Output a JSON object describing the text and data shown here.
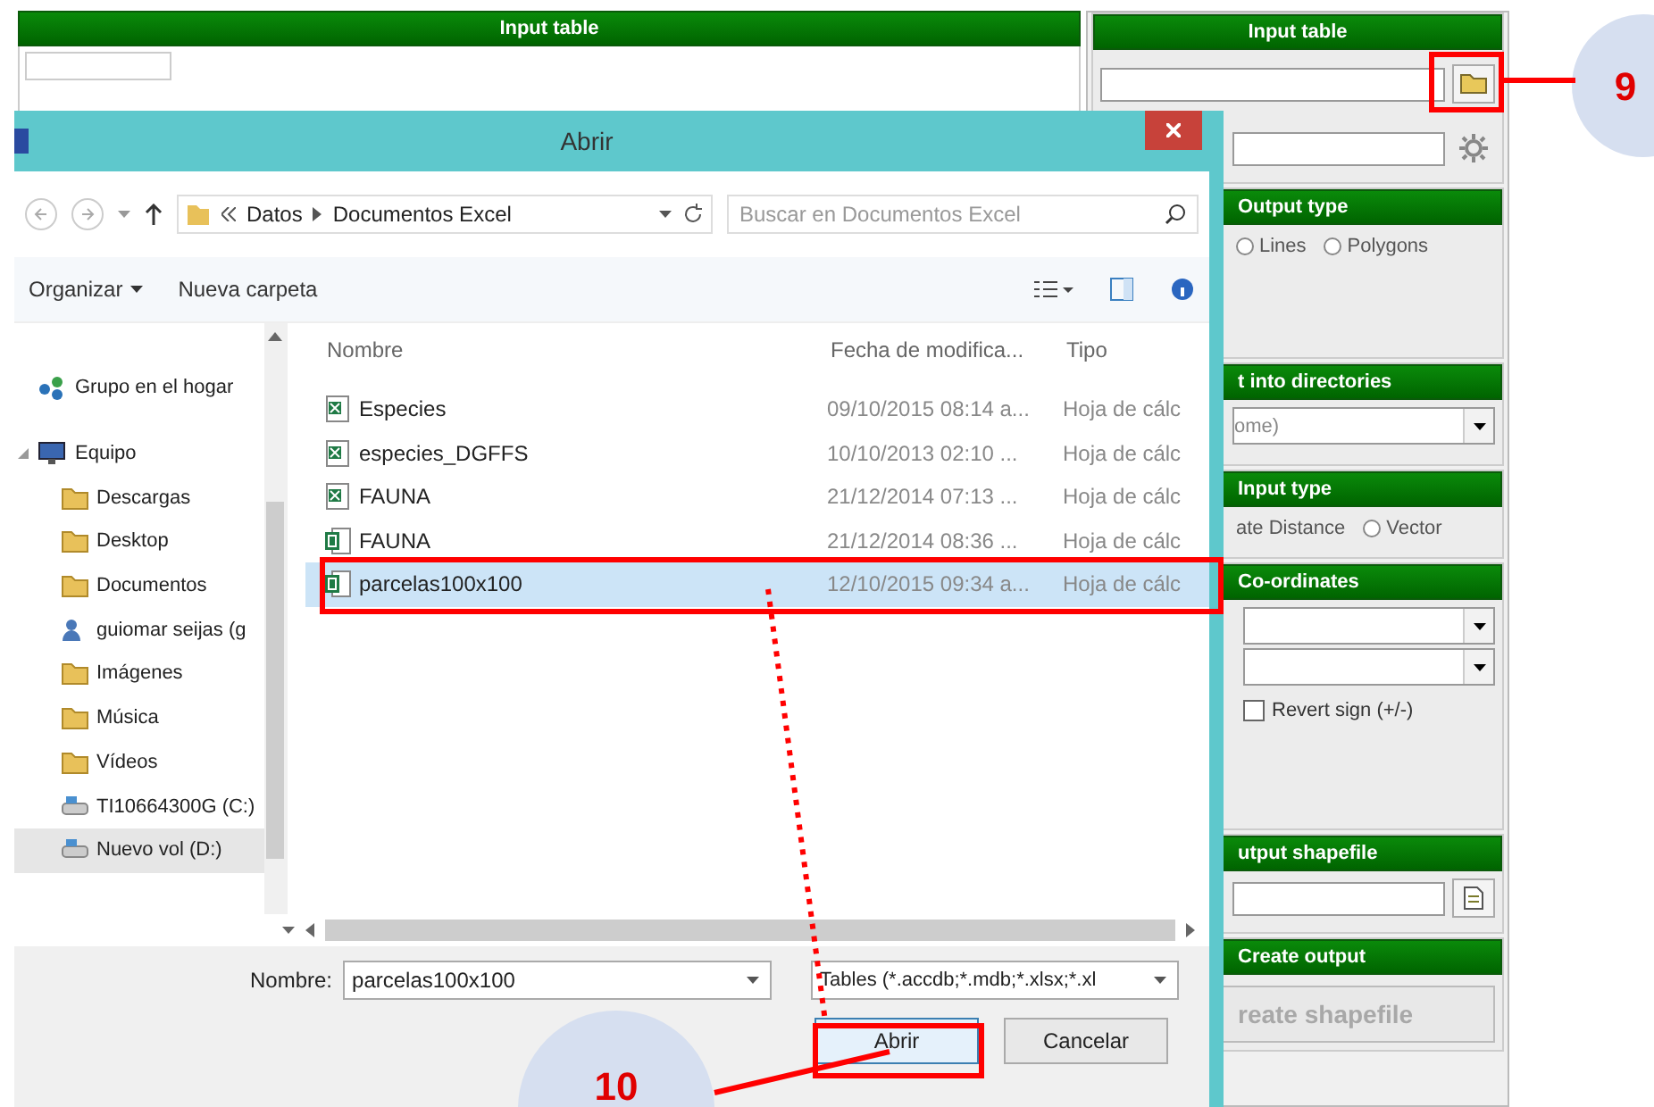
{
  "main_panel": {
    "header": "Input table"
  },
  "side_panel": {
    "input_table": {
      "header": "Input table"
    },
    "output_type": {
      "header": "Output type",
      "options": [
        {
          "label": "Lines",
          "selected": false
        },
        {
          "label": "Polygons",
          "selected": false
        }
      ]
    },
    "directories": {
      "header": "t into directories",
      "value": "ome)"
    },
    "input_type": {
      "header": "Input type",
      "options": [
        {
          "label": "ate Distance",
          "kind": "label",
          "selected": false
        },
        {
          "label": "Vector",
          "kind": "radio",
          "selected": false
        }
      ]
    },
    "coordinates": {
      "header": "Co-ordinates",
      "revert_sign": {
        "label": "Revert sign (+/-)",
        "checked": false
      }
    },
    "output_shapefile": {
      "header": "utput shapefile"
    },
    "create_output": {
      "header": "Create output",
      "button": {
        "label": "reate shapefile",
        "disabled": true
      }
    }
  },
  "dialog": {
    "title": "Abrir",
    "breadcrumb": [
      "Datos",
      "Documentos Excel"
    ],
    "search": {
      "placeholder": "Buscar en Documentos Excel"
    },
    "toolbar": [
      {
        "label": "Organizar",
        "kind": "menu"
      },
      {
        "label": "Nueva carpeta",
        "kind": "action"
      }
    ],
    "nav": [
      {
        "label": "Grupo en el hogar",
        "kind": "group",
        "selected": false
      },
      {
        "label": "Equipo",
        "kind": "computer",
        "expanded": true,
        "selected": false,
        "children": [
          {
            "label": "Descargas",
            "kind": "folder",
            "selected": false
          },
          {
            "label": "Desktop",
            "kind": "folder",
            "selected": false
          },
          {
            "label": "Documentos",
            "kind": "folder",
            "selected": false
          },
          {
            "label": "guiomar seijas (g",
            "kind": "user",
            "selected": false
          },
          {
            "label": "Imágenes",
            "kind": "folder",
            "selected": false
          },
          {
            "label": "Música",
            "kind": "folder",
            "selected": false
          },
          {
            "label": "Vídeos",
            "kind": "folder",
            "selected": false
          },
          {
            "label": "TI10664300G (C:)",
            "kind": "drive",
            "selected": false
          },
          {
            "label": "Nuevo vol (D:)",
            "kind": "drive",
            "selected": true
          }
        ]
      }
    ],
    "columns": [
      "Nombre",
      "Fecha de modifica...",
      "Tipo"
    ],
    "files": [
      {
        "name": "Especies",
        "modified": "09/10/2015 08:14 a...",
        "type": "Hoja de cálc",
        "kind": "sheet",
        "selected": false
      },
      {
        "name": "especies_DGFFS",
        "modified": "10/10/2013 02:10 ...",
        "type": "Hoja de cálc",
        "kind": "sheet",
        "selected": false
      },
      {
        "name": "FAUNA",
        "modified": "21/12/2014 07:13 ...",
        "type": "Hoja de cálc",
        "kind": "sheet",
        "selected": false
      },
      {
        "name": "FAUNA",
        "modified": "21/12/2014 08:36 ...",
        "type": "Hoja de cálc",
        "kind": "workbook",
        "selected": false
      },
      {
        "name": "parcelas100x100",
        "modified": "12/10/2015 09:34 a...",
        "type": "Hoja de cálc",
        "kind": "workbook",
        "selected": true
      }
    ],
    "file_name": {
      "label": "Nombre:",
      "value": "parcelas100x100"
    },
    "filter": "Tables (*.accdb;*.mdb;*.xlsx;*.xl",
    "buttons": [
      {
        "label": "Abrir",
        "kind": "primary"
      },
      {
        "label": "Cancelar",
        "kind": "secondary"
      }
    ]
  },
  "callouts": [
    {
      "label": "9"
    },
    {
      "label": "10"
    }
  ]
}
